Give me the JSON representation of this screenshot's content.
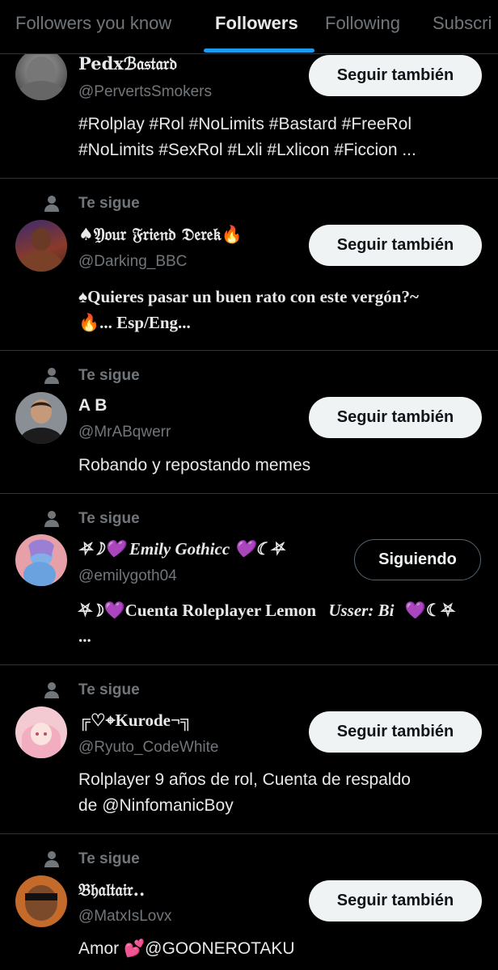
{
  "tabs": [
    {
      "label": "Followers you know"
    },
    {
      "label": "Followers"
    },
    {
      "label": "Following"
    },
    {
      "label": "Subscri"
    }
  ],
  "active_tab": "Followers",
  "rows": [
    {
      "name": "Pedxℬ𝔞𝔰𝔱𝔞𝔯𝔡",
      "handle": "@PervertsSmokers",
      "button": "Seguir también",
      "bio": [
        "#Rolplay #Rol #NoLimits #Bastard #FreeRol",
        "#NoLimits #SexRol #Lxli #Lxlicon #Ficcion ..."
      ]
    },
    {
      "context": "Te sigue",
      "name": "♠𝔜𝔬𝔲𝔯 𝔉𝔯𝔦𝔢𝔫𝔡 𝔇𝔢𝔯𝔢𝔨🔥",
      "handle": "@Darking_BBC",
      "button": "Seguir también",
      "bio": [
        "♠Quieres pasar un buen rato con este vergón?~",
        "🔥... Esp/Eng..."
      ]
    },
    {
      "context": "Te sigue",
      "name": "A B",
      "handle": "@MrABqwerr",
      "button": "Seguir también",
      "bio": [
        "Robando y repostando memes"
      ]
    },
    {
      "context": "Te sigue",
      "name": "⛧☽💜 Emily Gothicc 💜☾⛧",
      "handle": "@emilygoth04",
      "button": "Siguiendo",
      "bio": [
        "⛧☽💜Cuenta Roleplayer Lemon",
        "Usser: Bi",
        "💜☾⛧",
        "..."
      ]
    },
    {
      "context": "Te sigue",
      "name": "╔♡⌖Kurode¬╗",
      "handle": "@Ryuto_CodeWhite",
      "button": "Seguir también",
      "bio": [
        "Rolplayer 9 años de rol, Cuenta de respaldo",
        "de @NinfomanicBoy"
      ]
    },
    {
      "context": "Te sigue",
      "name": "𝔅𝔥𝔞𝔩𝔱𝔞𝔦𝔯..",
      "handle": "@MatxIsLovx",
      "button": "Seguir también",
      "bio": [
        "Amor 💕@GOONEROTAKU"
      ]
    }
  ],
  "colors": {
    "background": "#000000",
    "text": "#e7e9ea",
    "muted": "#71767b",
    "accent": "#1d9bf0",
    "follow_button_bg": "#eff3f4",
    "divider": "#2f3336"
  }
}
